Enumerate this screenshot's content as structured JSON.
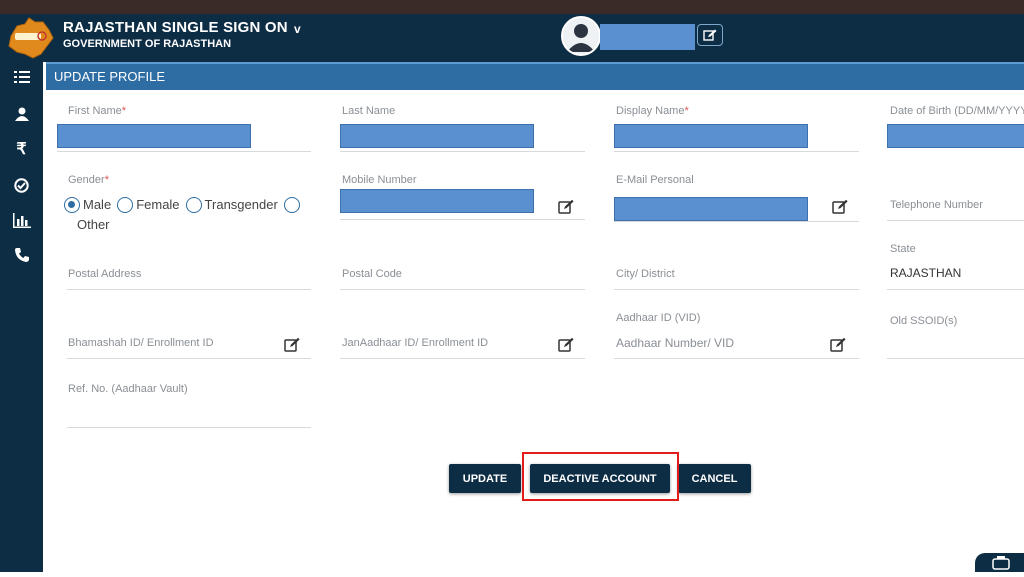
{
  "header": {
    "title": "RAJASTHAN SINGLE SIGN ON",
    "caret": "v",
    "subtitle": "GOVERNMENT OF RAJASTHAN"
  },
  "sidebar": {
    "items": [
      "list-icon",
      "user-icon",
      "rupee-icon",
      "check-circle-icon",
      "bar-chart-icon",
      "phone-icon"
    ]
  },
  "panel": {
    "title": "UPDATE PROFILE"
  },
  "form": {
    "first_name": "First Name",
    "last_name": "Last Name",
    "display_name": "Display Name",
    "dob": "Date of Birth (DD/MM/YYYY",
    "gender": "Gender",
    "gender_options": [
      "Male",
      "Female",
      "Transgender",
      "Other"
    ],
    "gender_selected": "Male",
    "mobile": "Mobile Number",
    "email": "E-Mail Personal",
    "telephone": "Telephone Number",
    "state": "State",
    "state_value": "RAJASTHAN",
    "postal_address": "Postal Address",
    "postal_code": "Postal Code",
    "city": "City/ District",
    "aadhaar": "Aadhaar ID (VID)",
    "aadhaar_placeholder": "Aadhaar Number/ VID",
    "bhamashah": "Bhamashah ID/ Enrollment ID",
    "janaadhaar": "JanAadhaar ID/ Enrollment ID",
    "old_ssoid": "Old SSOID(s)",
    "ref_no": "Ref. No. (Aadhaar Vault)",
    "required_mark": "*"
  },
  "buttons": {
    "update": "UPDATE",
    "deactive": "DEACTIVE ACCOUNT",
    "cancel": "CANCEL"
  },
  "colors": {
    "header_bg": "#0d2d44",
    "panel_bg": "#2d6da3",
    "redacted_fill": "#5a8fd0",
    "highlight": "#e31b1b"
  }
}
